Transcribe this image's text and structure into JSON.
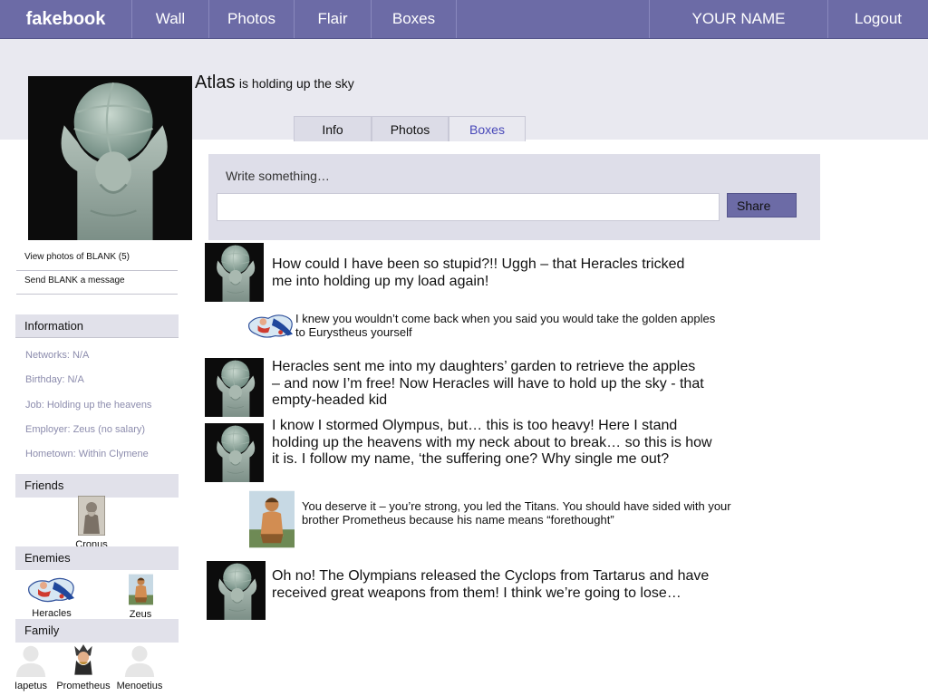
{
  "nav": {
    "brand": "fakebook",
    "items": [
      "Wall",
      "Photos",
      "Flair",
      "Boxes"
    ],
    "user": "YOUR NAME",
    "logout": "Logout"
  },
  "profile": {
    "name": "Atlas",
    "status": "is holding up the sky"
  },
  "tabs": [
    "Info",
    "Photos",
    "Boxes"
  ],
  "active_tab": "Boxes",
  "composer": {
    "label": "Write something…",
    "share": "Share"
  },
  "side_links": [
    "View photos of BLANK (5)",
    "Send BLANK a message"
  ],
  "information": {
    "title": "Information",
    "rows": [
      "Networks: N/A",
      "Birthday: N/A",
      "Job: Holding up the heavens",
      "Employer: Zeus (no salary)",
      "Hometown: Within Clymene"
    ]
  },
  "friends": {
    "title": "Friends",
    "people": [
      "Cronus"
    ]
  },
  "enemies": {
    "title": "Enemies",
    "people": [
      "Heracles",
      "Zeus"
    ]
  },
  "family": {
    "title": "Family",
    "people": [
      "Iapetus",
      "Prometheus",
      "Menoetius"
    ]
  },
  "posts": [
    {
      "text": "How could I have been so stupid?!! Uggh – that Heracles tricked me into holding up my load again!"
    },
    {
      "text": "I knew you wouldn’t come back when you said you would take the golden apples to Eurystheus yourself"
    },
    {
      "text": "Heracles sent me into my daughters’ garden to retrieve the apples – and now I’m free!  Now Heracles will have to hold up the sky - that empty-headed kid"
    },
    {
      "text": "I know I stormed Olympus, but… this is too heavy!  Here I stand holding up the heavens with my neck about to break… so this is how it is.  I follow my name, ‘the suffering one?  Why single me out?"
    },
    {
      "text": "You deserve it – you’re strong, you led the Titans.  You should have sided with your brother Prometheus because his name means “forethought”"
    },
    {
      "text": "Oh no!  The Olympians released the Cyclops from Tartarus and have received great weapons from them!  I think we’re going to lose…"
    }
  ],
  "colors": {
    "nav_bg": "#6c6ba6",
    "band_bg": "#e9e9f0",
    "active_tab": "#4747b8",
    "info_text": "#8c8cad"
  }
}
